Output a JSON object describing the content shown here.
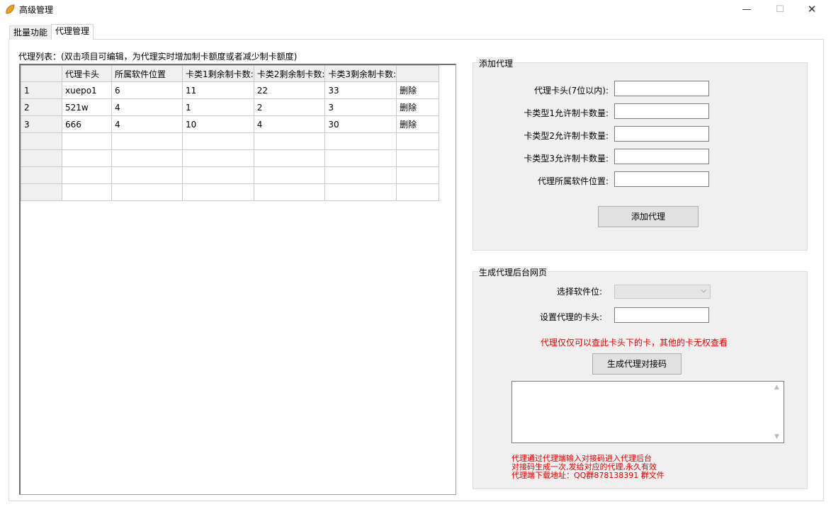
{
  "window": {
    "title": "高级管理",
    "minimize": "—",
    "maximize": "☐",
    "close": "✕"
  },
  "tabs": [
    "批量功能",
    "代理管理"
  ],
  "list": {
    "label": "代理列表：(双击项目可编辑，为代理实时增加制卡额度或者减少制卡额度)",
    "columns": [
      "",
      "代理卡头",
      "所属软件位置",
      "卡类1剩余制卡数:",
      "卡类2剩余制卡数:",
      "卡类3剩余制卡数:",
      ""
    ],
    "rows": [
      [
        "1",
        "xuepo1",
        "6",
        "11",
        "22",
        "33",
        "删除"
      ],
      [
        "2",
        "521w",
        "4",
        "1",
        "2",
        "3",
        "删除"
      ],
      [
        "3",
        "666",
        "4",
        "10",
        "4",
        "30",
        "删除"
      ],
      [
        "",
        "",
        "",
        "",
        "",
        "",
        ""
      ],
      [
        "",
        "",
        "",
        "",
        "",
        "",
        ""
      ],
      [
        "",
        "",
        "",
        "",
        "",
        "",
        ""
      ],
      [
        "",
        "",
        "",
        "",
        "",
        "",
        ""
      ]
    ]
  },
  "add_agent": {
    "title": "添加代理",
    "card_head_label": "代理卡头(7位以内):",
    "type1_label": "卡类型1允许制卡数量:",
    "type2_label": "卡类型2允许制卡数量:",
    "type3_label": "卡类型3允许制卡数量:",
    "software_label": "代理所属软件位置:",
    "button": "添加代理"
  },
  "generate": {
    "title": "生成代理后台网页",
    "select_label": "选择软件位:",
    "select_value": "",
    "card_head_label": "设置代理的卡头:",
    "warning": "代理仅仅可以查此卡头下的卡，其他的卡无权查看",
    "button": "生成代理对接码",
    "notes": [
      "代理通过代理端输入对接码进入代理后台",
      "对接码生成一次,发给对应的代理,永久有效",
      "代理端下载地址：QQ群878138391 群文件"
    ]
  }
}
